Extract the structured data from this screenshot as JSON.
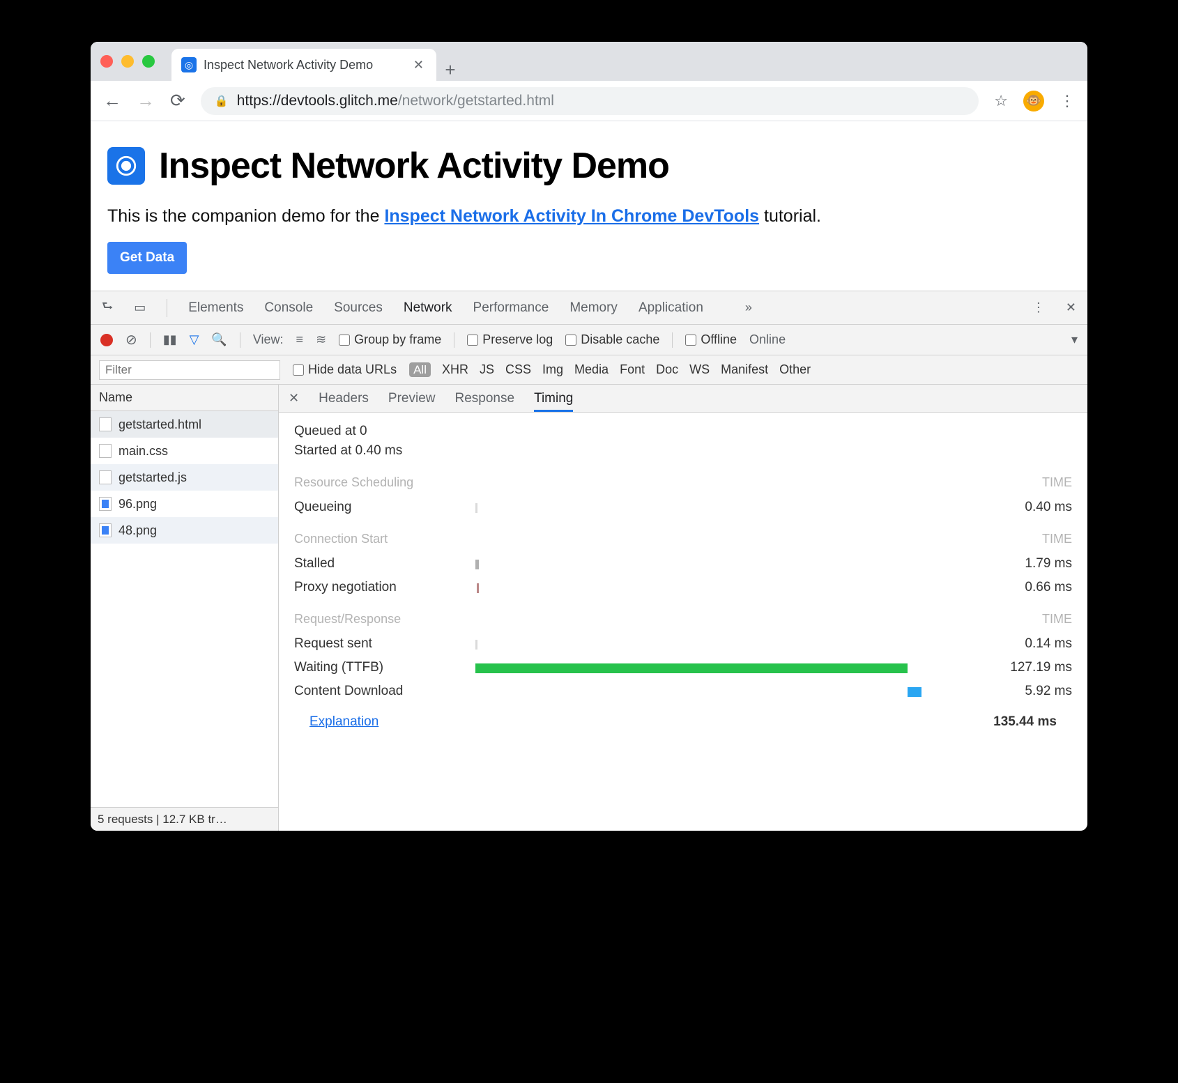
{
  "browser": {
    "tab_title": "Inspect Network Activity Demo",
    "url_secure_prefix": "https://",
    "url_host": "devtools.glitch.me",
    "url_path": "/network/getstarted.html"
  },
  "page": {
    "title": "Inspect Network Activity Demo",
    "intro_prefix": "This is the companion demo for the ",
    "intro_link": "Inspect Network Activity In Chrome DevTools",
    "intro_suffix": " tutorial.",
    "get_data_button": "Get Data"
  },
  "devtools": {
    "main_tabs": [
      "Elements",
      "Console",
      "Sources",
      "Network",
      "Performance",
      "Memory",
      "Application"
    ],
    "active_main_tab": "Network",
    "controls": {
      "view_label": "View:",
      "group_by_frame": "Group by frame",
      "preserve_log": "Preserve log",
      "disable_cache": "Disable cache",
      "offline": "Offline",
      "online": "Online"
    },
    "filters": {
      "placeholder": "Filter",
      "hide_data_urls": "Hide data URLs",
      "types": [
        "All",
        "XHR",
        "JS",
        "CSS",
        "Img",
        "Media",
        "Font",
        "Doc",
        "WS",
        "Manifest",
        "Other"
      ]
    },
    "request_list": {
      "header": "Name",
      "items": [
        {
          "name": "getstarted.html",
          "icon": "doc",
          "selected": true
        },
        {
          "name": "main.css",
          "icon": "doc"
        },
        {
          "name": "getstarted.js",
          "icon": "doc"
        },
        {
          "name": "96.png",
          "icon": "img"
        },
        {
          "name": "48.png",
          "icon": "img"
        }
      ],
      "status": "5 requests | 12.7 KB tr…"
    },
    "detail_tabs": [
      "Headers",
      "Preview",
      "Response",
      "Timing"
    ],
    "active_detail_tab": "Timing",
    "timing": {
      "queued_at": "Queued at 0",
      "started_at": "Started at 0.40 ms",
      "sections": [
        {
          "title": "Resource Scheduling",
          "time_header": "TIME",
          "rows": [
            {
              "label": "Queueing",
              "value": "0.40 ms",
              "barClass": "q"
            }
          ]
        },
        {
          "title": "Connection Start",
          "time_header": "TIME",
          "rows": [
            {
              "label": "Stalled",
              "value": "1.79 ms",
              "barClass": "st"
            },
            {
              "label": "Proxy negotiation",
              "value": "0.66 ms",
              "barClass": "px"
            }
          ]
        },
        {
          "title": "Request/Response",
          "time_header": "TIME",
          "rows": [
            {
              "label": "Request sent",
              "value": "0.14 ms",
              "barClass": "rs"
            },
            {
              "label": "Waiting (TTFB)",
              "value": "127.19 ms",
              "barClass": "wt"
            },
            {
              "label": "Content Download",
              "value": "5.92 ms",
              "barClass": "cd"
            }
          ]
        }
      ],
      "explanation_link": "Explanation",
      "total": "135.44 ms"
    }
  }
}
